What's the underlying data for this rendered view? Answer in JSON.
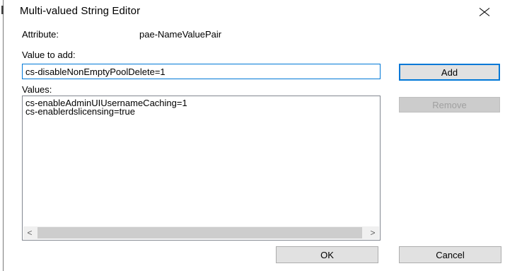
{
  "dialog": {
    "title": "Multi-valued String Editor"
  },
  "attribute": {
    "label": "Attribute:",
    "value": "pae-NameValuePair"
  },
  "value_to_add": {
    "label": "Value to add:",
    "value": "cs-disableNonEmptyPoolDelete=1"
  },
  "values": {
    "label": "Values:",
    "items": [
      "cs-enableAdminUIUsernameCaching=1",
      "cs-enablerdslicensing=true"
    ]
  },
  "buttons": {
    "add": "Add",
    "remove": "Remove",
    "ok": "OK",
    "cancel": "Cancel"
  },
  "scrollbar": {
    "left_arrow": "<",
    "right_arrow": ">"
  },
  "icons": {
    "close": "close-icon"
  },
  "colors": {
    "focus_border": "#0078d7",
    "button_face": "#e1e1e1",
    "disabled_face": "#cccccc",
    "disabled_text": "#a0a0a0"
  }
}
